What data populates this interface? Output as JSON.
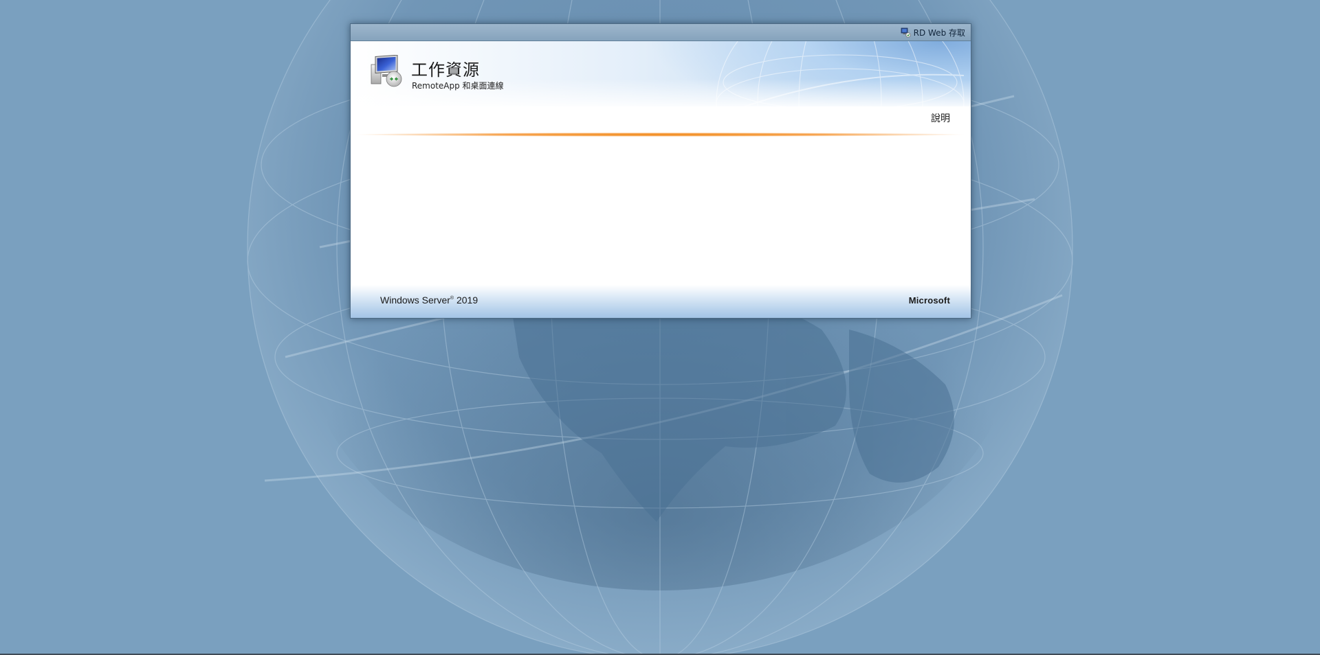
{
  "topbar": {
    "access_label": "RD Web 存取"
  },
  "header": {
    "title": "工作資源",
    "subtitle": "RemoteApp 和桌面連線",
    "help_label": "說明"
  },
  "footer": {
    "product_name": "Windows Server",
    "product_mark": "®",
    "product_version": "2019",
    "brand": "Microsoft"
  },
  "colors": {
    "page_background": "#7aa0bf",
    "accent_line": "#f08a1a",
    "topbar": "#9db6cc"
  },
  "icons": {
    "access": "rd-web-access-icon",
    "app": "remote-desktop-icon",
    "background": "globe-illustration"
  }
}
